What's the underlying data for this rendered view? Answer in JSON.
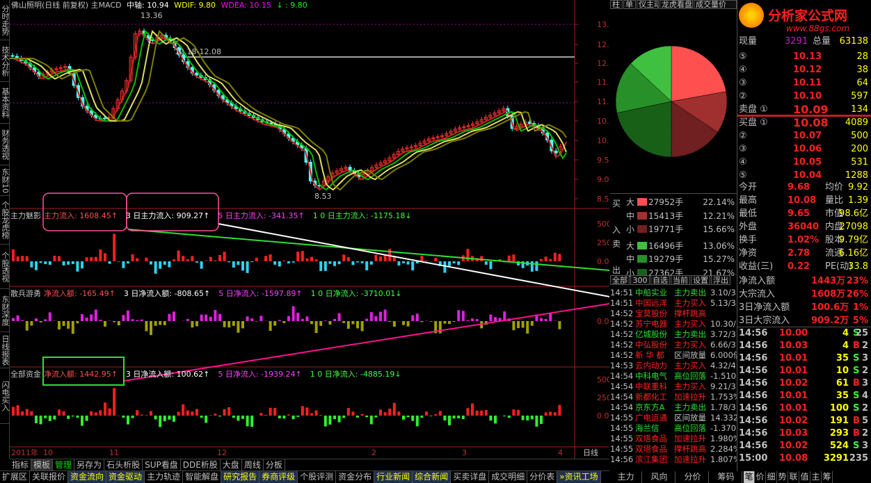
{
  "left_tabs": [
    "分时走势",
    "技术分析",
    "基本资料",
    "财务透视",
    "东财10",
    "个股龙虎榜",
    "个股透视",
    "东财深度",
    "日线报表",
    "闪电买入"
  ],
  "header": {
    "stock": "佛山照明(日线 前复权) 主MACD",
    "mid": "中轴: 10.94",
    "wdif": "WDIF: 9.80",
    "wdea": "WDEA: 10.15",
    "wval": "↓ : 9.80"
  },
  "price_axis": [
    "13.00",
    "12.50",
    "12.00",
    "11.50",
    "11.00",
    "10.50",
    "10.00",
    "9.50",
    "9.00",
    "8.50"
  ],
  "annotations": {
    "high": "13.36",
    "range": "12.18-12.08",
    "low": "8.53"
  },
  "panel1": {
    "name": "主力魅影",
    "l1": "主力流入: 1608.45",
    "l2": "3 日主力流入: 909.27",
    "l3": "5 日主力流入: -341.35",
    "l4": "1 0 日主力流入: -1175.18",
    "axis": [
      "5000",
      "2500",
      "0.00"
    ]
  },
  "panel2": {
    "name": "散兵游勇",
    "l1": "净流入额: -165.49",
    "l2": "3 日净流入额: -808.65",
    "l3": "5 日净流入: -1597.89",
    "l4": "1 0 日净流入: -3710.01",
    "axis": [
      "0.00"
    ]
  },
  "panel3": {
    "name": "全部资金",
    "l1": "净流入额: 1442.95",
    "l2": "3 日净流入额: 100.62",
    "l3": "5 日净流入: -1939.24",
    "l4": "1 0 日净流入: -4885.19",
    "axis": [
      "5000",
      "2500",
      "0.00"
    ]
  },
  "date_axis": {
    "y2011": "2011年",
    "m10": "10",
    "m11": "11",
    "m12": "12",
    "m2": "2",
    "m3": "3",
    "m4": "4",
    "period": "日线"
  },
  "right_tabs": [
    "柱",
    "单",
    "仪主动",
    "龙虎看盘",
    "成交量价"
  ],
  "logo": {
    "name": "分析家公式网",
    "url": "www.88gs.com"
  },
  "volume_row": {
    "label": "现量",
    "v": "3291",
    "label2": "总量",
    "v2": "63138"
  },
  "sell": [
    {
      "lvl": "⑤",
      "p": "10.13",
      "v": "28"
    },
    {
      "lvl": "④",
      "p": "10.12",
      "v": "38"
    },
    {
      "lvl": "③",
      "p": "10.11",
      "v": "64"
    },
    {
      "lvl": "②",
      "p": "10.10",
      "v": "597"
    },
    {
      "lvl": "卖盘 ①",
      "p": "10.09",
      "v": "134"
    }
  ],
  "buy": [
    {
      "lvl": "买盘 ①",
      "p": "10.08",
      "v": "4089"
    },
    {
      "lvl": "②",
      "p": "10.07",
      "v": "500"
    },
    {
      "lvl": "③",
      "p": "10.06",
      "v": "200"
    },
    {
      "lvl": "④",
      "p": "10.05",
      "v": "531"
    },
    {
      "lvl": "⑤",
      "p": "10.04",
      "v": "1288"
    }
  ],
  "stats": [
    {
      "a": "今开",
      "av": "9.68",
      "b": "均价",
      "bv": "9.92"
    },
    {
      "a": "最高",
      "av": "10.08",
      "b": "量比",
      "bv": "1.39"
    },
    {
      "a": "最低",
      "av": "9.65",
      "b": "市值",
      "bv": "98.6亿"
    },
    {
      "a": "外盘",
      "av": "36040",
      "b": "内盘",
      "bv": "27098"
    },
    {
      "a": "换手",
      "av": "1.02%",
      "b": "股本",
      "bv": "9.79亿"
    },
    {
      "a": "净资",
      "av": "2.78",
      "b": "流通",
      "bv": "6.16亿"
    },
    {
      "a": "收益(三)",
      "av": "0.22",
      "b": "PE(动)",
      "bv": "33.8"
    }
  ],
  "flows": [
    {
      "label": "净流入额",
      "v": "1443万",
      "p": "23%"
    },
    {
      "label": "大宗流入",
      "v": "1608万",
      "p": "26%"
    },
    {
      "label": "3日净流入额",
      "v": "100.6万",
      "p": "1%"
    },
    {
      "label": "3日大宗流入",
      "v": "909.2万",
      "p": "5%"
    }
  ],
  "pie_table": {
    "buy_label": [
      "买",
      "入"
    ],
    "sell_label": [
      "卖",
      "出"
    ],
    "rows": [
      {
        "k": "大",
        "v": "27952手",
        "p": "22.14%",
        "c": "#ff5050"
      },
      {
        "k": "中",
        "v": "15413手",
        "p": "12.21%",
        "c": "#a03030"
      },
      {
        "k": "小",
        "v": "19771手",
        "p": "15.66%",
        "c": "#702020"
      },
      {
        "k": "大",
        "v": "16496手",
        "p": "13.06%",
        "c": "#40c040"
      },
      {
        "k": "中",
        "v": "19279手",
        "p": "15.27%",
        "c": "#289028"
      },
      {
        "k": "小",
        "v": "27362手",
        "p": "21.67%",
        "c": "#186018"
      }
    ]
  },
  "sub_tabs": [
    "全部",
    "300",
    "自选",
    "当前",
    "设置",
    "浮出"
  ],
  "news": [
    {
      "t": "14:51",
      "n": "中船实业",
      "e": "主力卖出",
      "v": "3.10/3"
    },
    {
      "t": "14:51",
      "n": "中国远洋",
      "e": "主力买入",
      "v": "5.13/3"
    },
    {
      "t": "14:52",
      "n": "宝莫股份",
      "e": "撑杆跳高",
      "v": ""
    },
    {
      "t": "14:52",
      "n": "苏宁电器",
      "e": "主力买入",
      "v": "10.30/"
    },
    {
      "t": "14:52",
      "n": "亿城股份",
      "e": "主力卖出",
      "v": "3.72/3"
    },
    {
      "t": "14:52",
      "n": "中弘股份",
      "e": "主力买入",
      "v": "6.66/3"
    },
    {
      "t": "14:52",
      "n": "新 华 都",
      "e": "区间放量",
      "v": "6.000倍"
    },
    {
      "t": "14:53",
      "n": "云内动力",
      "e": "主力买入",
      "v": "4.32/4"
    },
    {
      "t": "14:54",
      "n": "中科电气",
      "e": "高位回落",
      "v": "-1.510"
    },
    {
      "t": "14:54",
      "n": "中联重科",
      "e": "主力买入",
      "v": "9.21/3"
    },
    {
      "t": "14:54",
      "n": "新都化工",
      "e": "加速拉升",
      "v": "1.753%"
    },
    {
      "t": "14:54",
      "n": "京东方A",
      "e": "主力卖出",
      "v": "1.78/3"
    },
    {
      "t": "14:55",
      "n": "广电运通",
      "e": "区间放量",
      "v": "14.332"
    },
    {
      "t": "14:55",
      "n": "海兰信",
      "e": "高位回落",
      "v": "-1.370"
    },
    {
      "t": "14:55",
      "n": "双塔食品",
      "e": "加速拉升",
      "v": "1.980%"
    },
    {
      "t": "14:55",
      "n": "双塔食品",
      "e": "撑杆跳高",
      "v": "2.284%"
    },
    {
      "t": "14:56",
      "n": "滨江集团",
      "e": "加速拉升",
      "v": "1.807%"
    }
  ],
  "ticks": [
    {
      "t": "14:56",
      "p": "10.00",
      "v": "4",
      "d": "S",
      "n": "25"
    },
    {
      "t": "14:56",
      "p": "10.03",
      "v": "4",
      "d": "B",
      "n": "2"
    },
    {
      "t": "14:56",
      "p": "10.01",
      "v": "35",
      "d": "S",
      "n": "3"
    },
    {
      "t": "14:56",
      "p": "10.01",
      "v": "10",
      "d": "S",
      "n": "2"
    },
    {
      "t": "14:56",
      "p": "10.02",
      "v": "61",
      "d": "B",
      "n": "3"
    },
    {
      "t": "14:56",
      "p": "10.01",
      "v": "35",
      "d": "S",
      "n": "4"
    },
    {
      "t": "14:56",
      "p": "10.01",
      "v": "100",
      "d": "S",
      "n": "2"
    },
    {
      "t": "14:56",
      "p": "10.02",
      "v": "191",
      "d": "B",
      "n": "5"
    },
    {
      "t": "14:56",
      "p": "10.03",
      "v": "293",
      "d": "B",
      "n": "2"
    },
    {
      "t": "14:56",
      "p": "10.02",
      "v": "524",
      "d": "S",
      "n": "3"
    },
    {
      "t": "15:00",
      "p": "10.08",
      "v": "3291",
      "d": "",
      "n": "235"
    }
  ],
  "bottom_tabs1": [
    "指标",
    "模板",
    "管理",
    "另存为",
    "石头析股",
    "SUP看盘",
    "DDE析股",
    "大盘",
    "周线",
    "分板"
  ],
  "bottom_tabs2": [
    "扩展区",
    "关联报价",
    "资金流向",
    "资金驱动",
    "主力轨迹",
    "智能解盘",
    "研究报告",
    "券商评级",
    "个股评测",
    "资金分布",
    "行业新闻",
    "综合新闻",
    "买卖详盘",
    "成交明细",
    "分价表",
    "»资讯工场"
  ],
  "right_bottom": [
    "主力",
    "风向",
    "分价",
    "筹码",
    "笔",
    "价",
    "细",
    "势",
    "联",
    "值",
    "主",
    "筹"
  ],
  "colors": {
    "up": "#ff3232",
    "down": "#54fcfc",
    "green": "#00e600",
    "yellow": "#ffff00",
    "magenta": "#ff00ff",
    "olive": "#a0a000"
  }
}
